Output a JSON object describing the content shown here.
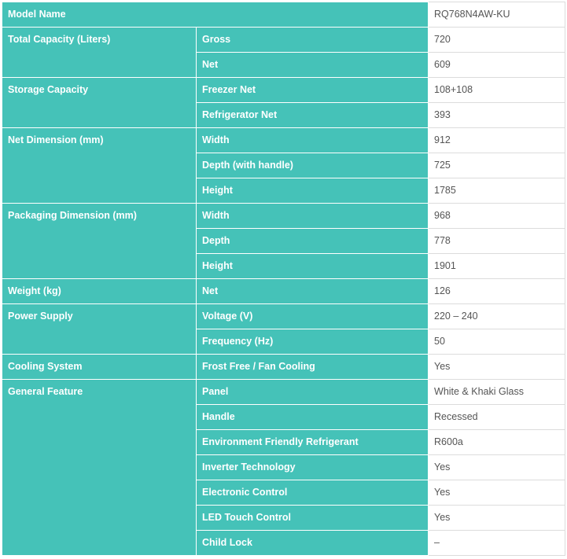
{
  "model_name": {
    "label": "Model Name",
    "value": "RQ768N4AW-KU"
  },
  "groups": [
    {
      "label": "Total Capacity (Liters)",
      "rows": [
        {
          "label": "Gross",
          "value": "720"
        },
        {
          "label": "Net",
          "value": "609"
        }
      ]
    },
    {
      "label": "Storage Capacity",
      "rows": [
        {
          "label": "Freezer Net",
          "value": "108+108"
        },
        {
          "label": "Refrigerator Net",
          "value": "393"
        }
      ]
    },
    {
      "label": "Net Dimension (mm)",
      "rows": [
        {
          "label": "Width",
          "value": "912"
        },
        {
          "label": "Depth (with handle)",
          "value": "725"
        },
        {
          "label": "Height",
          "value": "1785"
        }
      ]
    },
    {
      "label": "Packaging Dimension (mm)",
      "rows": [
        {
          "label": "Width",
          "value": "968"
        },
        {
          "label": "Depth",
          "value": "778"
        },
        {
          "label": "Height",
          "value": "1901"
        }
      ]
    },
    {
      "label": "Weight (kg)",
      "rows": [
        {
          "label": "Net",
          "value": "126"
        }
      ]
    },
    {
      "label": "Power Supply",
      "rows": [
        {
          "label": "Voltage (V)",
          "value": "220 – 240"
        },
        {
          "label": "Frequency (Hz)",
          "value": "50"
        }
      ]
    },
    {
      "label": "Cooling System",
      "rows": [
        {
          "label": "Frost Free / Fan Cooling",
          "value": "Yes"
        }
      ]
    },
    {
      "label": "General Feature",
      "rows": [
        {
          "label": "Panel",
          "value": "White & Khaki Glass"
        },
        {
          "label": "Handle",
          "value": "Recessed"
        },
        {
          "label": "Environment Friendly Refrigerant",
          "value": "R600a"
        },
        {
          "label": "Inverter Technology",
          "value": "Yes"
        },
        {
          "label": "Electronic Control",
          "value": "Yes"
        },
        {
          "label": "LED Touch Control",
          "value": "Yes"
        },
        {
          "label": "Child Lock",
          "value": "–"
        }
      ]
    }
  ],
  "colors": {
    "header_bg": "#45c2b8",
    "header_text": "#ffffff",
    "value_text": "#555555",
    "border": "#dcdcdc"
  }
}
